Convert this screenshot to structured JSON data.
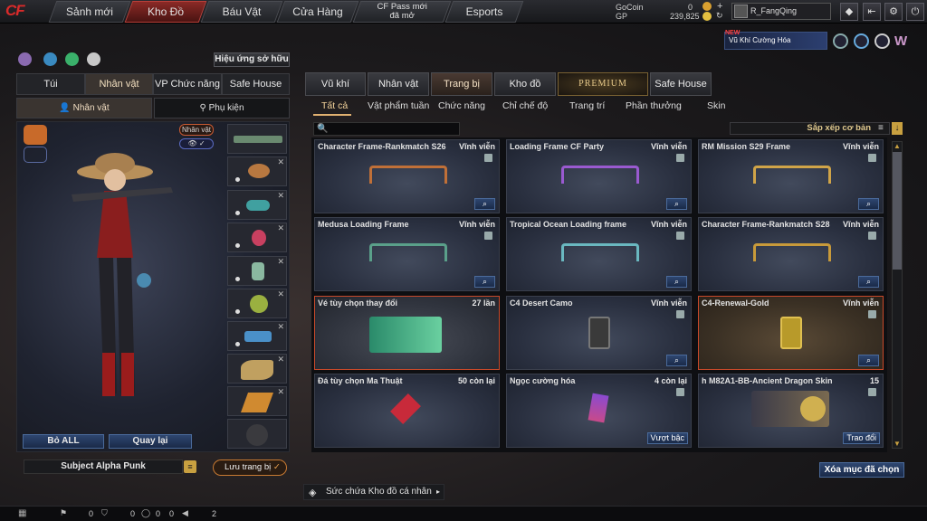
{
  "topnav": {
    "tabs": [
      "Sảnh mới",
      "Kho Đồ",
      "Báu Vật",
      "Cửa Hàng",
      "CF Pass mới đã mở",
      "Esports"
    ],
    "active_index": 1,
    "gocoin_label": "GoCoin",
    "gocoin_value": "0",
    "gp_label": "GP",
    "gp_value": "239,825",
    "username": "R_FangQing",
    "promo_new": "NEW",
    "promo_text": "Vũ Khí Cường Hóa"
  },
  "left": {
    "effect_button": "Hiệu ứng sở hữu",
    "tabs": [
      "Túi",
      "Nhân vật",
      "VP Chức năng",
      "Safe House"
    ],
    "active_tab": 1,
    "subtabs": [
      "Nhân vật",
      "Phụ kiện"
    ],
    "char_badge": "Nhân vật",
    "btn_remove_all": "Bỏ ALL",
    "btn_back": "Quay lại",
    "character_name": "Subject Alpha Punk",
    "save_button": "Lưu trang bị"
  },
  "right": {
    "tabs": [
      "Vũ khí",
      "Nhân vật",
      "Trang bị",
      "Kho đồ",
      "PREMIUM",
      "Safe House"
    ],
    "active_tab": 2,
    "filters": [
      "Tất cả",
      "Vật phẩm tuần",
      "Chức năng",
      "Chỉ chế độ",
      "Trang trí",
      "Phần thưởng",
      "Skin"
    ],
    "active_filter": 0,
    "sort_label": "Sắp xếp cơ bản",
    "items": [
      {
        "name": "Character Frame-Rankmatch S26",
        "duration": "Vĩnh viễn"
      },
      {
        "name": "Loading Frame CF Party",
        "duration": "Vĩnh viễn"
      },
      {
        "name": "RM Mission S29 Frame",
        "duration": "Vĩnh viễn"
      },
      {
        "name": "Medusa Loading Frame",
        "duration": "Vĩnh viễn"
      },
      {
        "name": "Tropical Ocean Loading frame",
        "duration": "Vĩnh viễn"
      },
      {
        "name": "Character Frame-Rankmatch S28",
        "duration": "Vĩnh viễn"
      },
      {
        "name": "Vé tùy chọn thay đổi",
        "duration": "27 lần"
      },
      {
        "name": "C4 Desert Camo",
        "duration": "Vĩnh viễn"
      },
      {
        "name": "C4-Renewal-Gold",
        "duration": "Vĩnh viễn"
      },
      {
        "name": "Đá tùy chọn Ma Thuật",
        "duration": "50 còn lại"
      },
      {
        "name": "Ngọc cường hóa",
        "duration": "4 còn lại",
        "action": "Vượt bậc"
      },
      {
        "name": "h M82A1-BB-Ancient Dragon Skin",
        "duration": "15",
        "action": "Trao đổi"
      }
    ],
    "magnify_label": "🔍",
    "delete_button": "Xóa mục đã chọn",
    "storage_label": "Sức chứa Kho đồ cá nhân"
  },
  "status": {
    "values": [
      "0",
      "0",
      "0",
      "0",
      "2"
    ]
  },
  "colors": {
    "accent_red": "#b8403a",
    "accent_blue": "#2e4670",
    "accent_gold": "#e0c98e"
  }
}
